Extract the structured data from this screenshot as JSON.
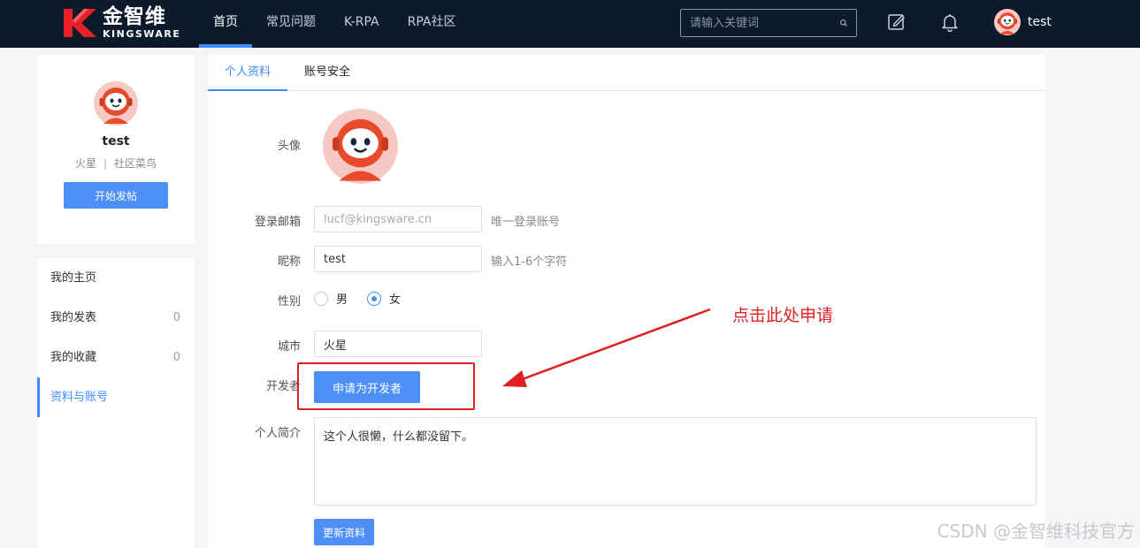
{
  "header": {
    "brand_cn": "金智维",
    "brand_en": "KINGSWARE",
    "nav": [
      {
        "label": "首页",
        "active": true
      },
      {
        "label": "常见问题",
        "active": false
      },
      {
        "label": "K-RPA",
        "active": false
      },
      {
        "label": "RPA社区",
        "active": false
      }
    ],
    "search_placeholder": "请输入关键词",
    "icons": [
      "edit-icon",
      "bell-icon",
      "avatar"
    ],
    "username": "test"
  },
  "profile": {
    "username": "test",
    "location": "火星",
    "separator": "|",
    "level": "社区菜鸟",
    "post_button": "开始发帖"
  },
  "menu": {
    "items": [
      {
        "label": "我的主页",
        "count": ""
      },
      {
        "label": "我的发表",
        "count": "0"
      },
      {
        "label": "我的收藏",
        "count": "0"
      },
      {
        "label": "资料与账号",
        "count": "",
        "active": true
      }
    ]
  },
  "tabs": [
    {
      "label": "个人资料",
      "active": true
    },
    {
      "label": "账号安全",
      "active": false
    }
  ],
  "form": {
    "avatar_label": "头像",
    "email_label": "登录邮箱",
    "email_value": "lucf@kingsware.cn",
    "email_hint": "唯一登录账号",
    "nickname_label": "昵称",
    "nickname_value": "test",
    "nickname_hint": "输入1-6个字符",
    "gender_label": "性别",
    "gender_options": [
      {
        "label": "男",
        "checked": false
      },
      {
        "label": "女",
        "checked": true
      }
    ],
    "city_label": "城市",
    "city_value": "火星",
    "developer_label": "开发者",
    "developer_button": "申请为开发者",
    "bio_label": "个人简介",
    "bio_value": "这个人很懒，什么都没留下。",
    "update_button": "更新资料"
  },
  "annotation": {
    "text": "点击此处申请",
    "color": "#e02020"
  },
  "watermark": "CSDN @金智维科技官方",
  "colors": {
    "nav_bg": "#0d1a2b",
    "accent": "#3f8cff",
    "button": "#4e8ff7"
  }
}
